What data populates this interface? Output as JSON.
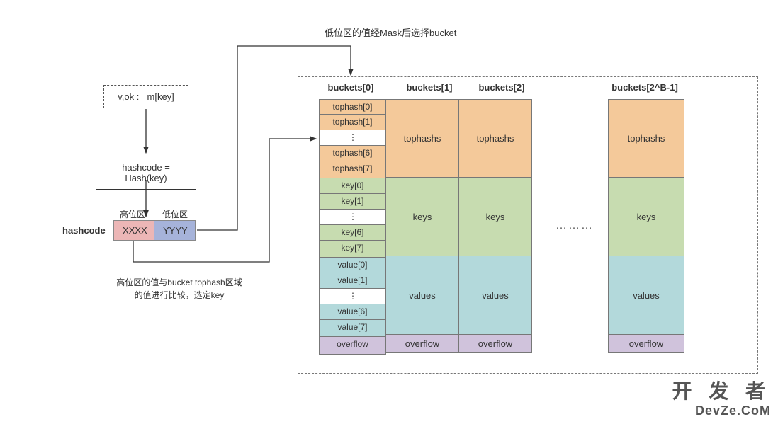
{
  "title_label": "低位区的值经Mask后选择bucket",
  "flow": {
    "step1": "v,ok := m[key]",
    "step2": "hashcode = Hash(key)"
  },
  "hashcode": {
    "label": "hashcode",
    "high_label": "高位区",
    "low_label": "低位区",
    "high_value": "XXXX",
    "low_value": "YYYY"
  },
  "high_compare_text_l1": "高位区的值与bucket tophash区域",
  "high_compare_text_l2": "的值进行比较，选定key",
  "buckets": {
    "headers": [
      "buckets[0]",
      "buckets[1]",
      "buckets[2]",
      "buckets[2^B-1]"
    ],
    "bucket0": {
      "tophash": [
        "tophash[0]",
        "tophash[1]",
        "⋮",
        "tophash[6]",
        "tophash[7]"
      ],
      "keys": [
        "key[0]",
        "key[1]",
        "⋮",
        "key[6]",
        "key[7]"
      ],
      "values": [
        "value[0]",
        "value[1]",
        "⋮",
        "value[6]",
        "value[7]"
      ],
      "overflow": "overflow"
    },
    "simple": {
      "tophash": "tophashs",
      "keys": "keys",
      "values": "values",
      "overflow": "overflow"
    },
    "dots": "………"
  },
  "watermark": {
    "line1_main": "开 发 者",
    "line2": "DevZe.CoM"
  }
}
